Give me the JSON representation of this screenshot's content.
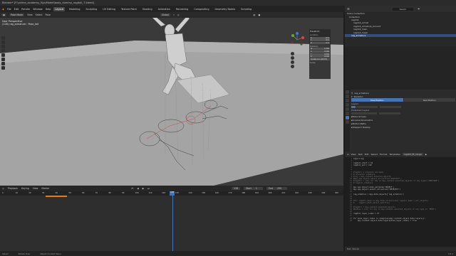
{
  "titlebar": {
    "text": "Blender* [F:\\anime_academy_5\\pvModel\\body_dummy_ragdoll_7.blend]"
  },
  "menubar": {
    "items": [
      "File",
      "Edit",
      "Render",
      "Window",
      "Help"
    ],
    "workspaces": [
      "Layout",
      "Modeling",
      "Sculpting",
      "UV Editing",
      "Texture Paint",
      "Shading",
      "Animation",
      "Rendering",
      "Compositing",
      "Geometry Nodes",
      "Scripting"
    ],
    "active_workspace": "Layout",
    "scene": "Scene",
    "view_layer": "ViewLayer"
  },
  "viewport": {
    "header": {
      "mode": "Pose Mode",
      "items": [
        "View",
        "Select",
        "Pose"
      ],
      "transform": "Global"
    },
    "overlay": {
      "view": "User Perspective",
      "object": "(128) rag_armature : Pose_tail"
    },
    "npanel": {
      "title": "Transform",
      "location_label": "Location:",
      "location": [
        [
          "X",
          "0 m"
        ],
        [
          "Y",
          "0 m"
        ],
        [
          "Z",
          "0 m"
        ]
      ],
      "rotation_label": "Rotation:",
      "rotation": [
        [
          "W",
          "1.000"
        ],
        [
          "X",
          "0.000"
        ],
        [
          "Y",
          "0.000"
        ],
        [
          "Z",
          "0.000"
        ]
      ],
      "mode": "Quaternion (WXYZ)",
      "scale_label": "Scale:"
    },
    "colors": {
      "floor": "#a8a8a8",
      "background": "#3a3a3a"
    }
  },
  "outliner": {
    "search_placeholder": "Search",
    "items": [
      {
        "label": "Scene Collection",
        "selected": false
      },
      {
        "label": "Collection",
        "selected": false
      },
      {
        "label": "ragdoll",
        "selected": false
      },
      {
        "label": "ragdoll_armat",
        "selected": false
      },
      {
        "label": "ragdoll_armature_Ground",
        "selected": false
      },
      {
        "label": "ragdoll_main",
        "selected": false
      },
      {
        "label": "ragdoll_mesh",
        "selected": false
      },
      {
        "label": "rag_armature",
        "selected": true
      }
    ]
  },
  "properties": {
    "object": "rag_armature",
    "section": "Skeleton",
    "toggle_pose": "Pose Position",
    "toggle_rest": "Rest Position",
    "layers_label": "Layers",
    "protected_label": "Protected Layers",
    "panels": [
      "Bone Groups",
      "Inverse Kinematics",
      "Motion Paths",
      "Viewport Display"
    ]
  },
  "text_editor": {
    "menu": [
      "View",
      "Text",
      "Edit",
      "Select",
      "Format",
      "Templates"
    ],
    "filename": "ragdoll_fit_range",
    "status": "Text: Internal",
    "lines": [
      {
        "n": "1",
        "t": "import bpy"
      },
      {
        "n": "2",
        "t": ""
      },
      {
        "n": "3",
        "t": "ragdoll_start = 10"
      },
      {
        "n": "4",
        "t": "ragdoll_end = 110"
      },
      {
        "n": "5",
        "t": ""
      },
      {
        "n": "6",
        "t": ""
      },
      {
        "n": "7",
        "t": "#ragdoll = armature and mesh"
      },
      {
        "n": "8",
        "t": "# character armature"
      },
      {
        "n": "9",
        "t": "#rig = bpy.context.selected_objects"
      },
      {
        "n": "10",
        "t": "#bpy.ops.object.select_all(action='DESELECT')"
      },
      {
        "n": "11",
        "t": "#ragdoll = [obj for obj in bpy.context.selected_objects if obj.type=='ARMATURE']"
      },
      {
        "n": "12",
        "t": "# ragdoll_armature"
      },
      {
        "n": "13",
        "t": ""
      },
      {
        "n": "14",
        "t": "bpy.ops.object.mode_set(mode='OBJECT')"
      },
      {
        "n": "15",
        "t": "bpy.ops.object.select_all(action='DESELECT')"
      },
      {
        "n": "16",
        "t": ""
      },
      {
        "n": "17",
        "t": "rag_armature = bpy.data.objects['rag_armature']"
      },
      {
        "n": "18",
        "t": ""
      },
      {
        "n": "19",
        "t": ""
      },
      {
        "n": "20",
        "t": "#for ragdoll_mesh in bpy.data.collections['ragdoll_mesh'].all_objects:"
      },
      {
        "n": "21",
        "t": "#    ragdoll_mesh.select_set(True)"
      },
      {
        "n": "22",
        "t": ""
      },
      {
        "n": "23",
        "t": "#ragdoll = bpy.context.selected_objects"
      },
      {
        "n": "24",
        "t": "#bodies = [obj for obj in bpy.context.selected_objects if obj.type == 'MESH']"
      },
      {
        "n": "25",
        "t": ""
      },
      {
        "n": "26",
        "t": "ragdoll_layer_index = 27"
      },
      {
        "n": "27",
        "t": ""
      },
      {
        "n": "28",
        "t": "for bone_layer_index in range(len(bpy.context.object.data.layers)):"
      },
      {
        "n": "29",
        "t": "    bpy.context.object.data.layers[bone_layer_index] = True"
      }
    ]
  },
  "timeline": {
    "menu": [
      "Playback",
      "Keying",
      "View",
      "Marker"
    ],
    "current_frame": "128",
    "start_label": "Start",
    "start": "1",
    "end_label": "End",
    "end": "250",
    "ruler": [
      "0",
      "10",
      "20",
      "30",
      "40",
      "50",
      "60",
      "70",
      "80",
      "90",
      "100",
      "110",
      "120",
      "130",
      "140",
      "150",
      "160",
      "170",
      "180",
      "190",
      "200",
      "210",
      "220",
      "230",
      "240",
      "250"
    ]
  },
  "statusbar": {
    "items": [
      "Select",
      "Rotate View",
      "Object Context Menu"
    ],
    "version": "3.3.1"
  }
}
